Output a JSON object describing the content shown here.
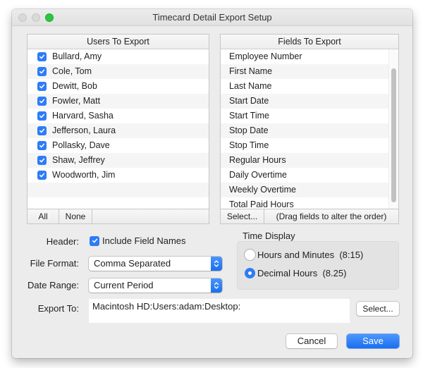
{
  "window": {
    "title": "Timecard Detail Export Setup"
  },
  "users_panel": {
    "header": "Users To Export",
    "users": [
      {
        "name": "Bullard, Amy",
        "checked": true
      },
      {
        "name": "Cole, Tom",
        "checked": true
      },
      {
        "name": "Dewitt, Bob",
        "checked": true
      },
      {
        "name": "Fowler, Matt",
        "checked": true
      },
      {
        "name": "Harvard, Sasha",
        "checked": true
      },
      {
        "name": "Jefferson, Laura",
        "checked": true
      },
      {
        "name": "Pollasky, Dave",
        "checked": true
      },
      {
        "name": "Shaw, Jeffrey",
        "checked": true
      },
      {
        "name": "Woodworth, Jim",
        "checked": true
      }
    ],
    "all_label": "All",
    "none_label": "None"
  },
  "fields_panel": {
    "header": "Fields To Export",
    "fields": [
      "Employee Number",
      "First Name",
      "Last Name",
      "Start Date",
      "Start Time",
      "Stop Date",
      "Stop Time",
      "Regular Hours",
      "Daily Overtime",
      "Weekly Overtime",
      "Total Paid Hours"
    ],
    "select_label": "Select...",
    "hint": "(Drag fields to alter the order)"
  },
  "options": {
    "header_label": "Header:",
    "include_field_names_label": "Include Field Names",
    "include_field_names_checked": true,
    "file_format_label": "File Format:",
    "file_format_value": "Comma Separated",
    "date_range_label": "Date Range:",
    "date_range_value": "Current Period",
    "export_to_label": "Export To:",
    "export_to_value": "Macintosh HD:Users:adam:Desktop:",
    "export_select_label": "Select..."
  },
  "time_display": {
    "title": "Time Display",
    "options": [
      {
        "label": "Hours and Minutes  (8:15)",
        "selected": false
      },
      {
        "label": "Decimal Hours  (8.25)",
        "selected": true
      }
    ]
  },
  "buttons": {
    "cancel": "Cancel",
    "save": "Save"
  },
  "colors": {
    "accent": "#2e7cf6",
    "zoom_button": "#29c740"
  }
}
